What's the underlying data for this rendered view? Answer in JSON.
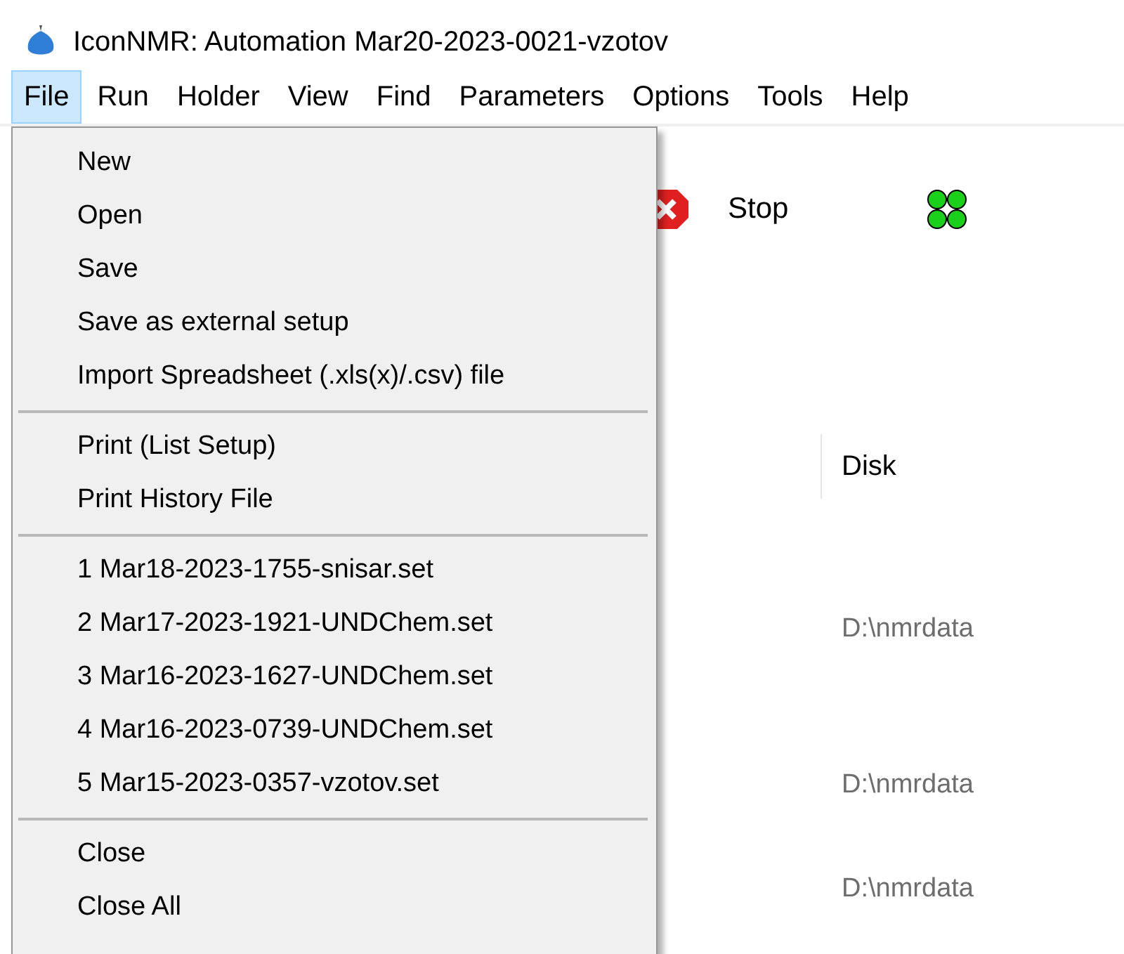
{
  "window": {
    "title": "IconNMR: Automation Mar20-2023-0021-vzotov"
  },
  "menu_bar": [
    {
      "label": "File",
      "selected": true
    },
    {
      "label": "Run",
      "selected": false
    },
    {
      "label": "Holder",
      "selected": false
    },
    {
      "label": "View",
      "selected": false
    },
    {
      "label": "Find",
      "selected": false
    },
    {
      "label": "Parameters",
      "selected": false
    },
    {
      "label": "Options",
      "selected": false
    },
    {
      "label": "Tools",
      "selected": false
    },
    {
      "label": "Help",
      "selected": false
    }
  ],
  "file_menu": {
    "groups": [
      [
        "New",
        "Open",
        "Save",
        "Save as external setup",
        "Import Spreadsheet (.xls(x)/.csv) file"
      ],
      [
        "Print (List Setup)",
        "Print History File"
      ],
      [
        "1 Mar18-2023-1755-snisar.set",
        "2 Mar17-2023-1921-UNDChem.set",
        "3 Mar16-2023-1627-UNDChem.set",
        "4 Mar16-2023-0739-UNDChem.set",
        "5 Mar15-2023-0357-vzotov.set"
      ],
      [
        "Close",
        "Close All"
      ]
    ]
  },
  "toolbar": [
    {
      "kind": "stop",
      "label": "Stop"
    },
    {
      "kind": "positions"
    }
  ],
  "table": {
    "columns": [
      "Disk"
    ],
    "rows": [
      {},
      {},
      {
        "disk": "D:\\nmrdata"
      },
      {},
      {},
      {
        "disk": "D:\\nmrdata"
      },
      {},
      {
        "disk": "D:\\nmrdata"
      }
    ]
  }
}
